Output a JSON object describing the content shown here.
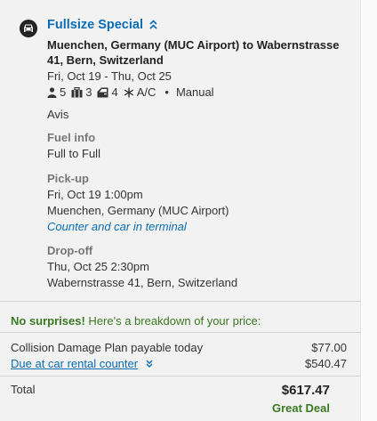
{
  "car": {
    "title": "Fullsize Special",
    "route": "Muenchen, Germany (MUC Airport) to Wabernstrasse 41, Bern, Switzerland",
    "dates": "Fri, Oct 19 - Thu, Oct 25",
    "features": {
      "passengers": "5",
      "bags": "3",
      "doors": "4",
      "ac": "A/C",
      "separator": "•",
      "transmission": "Manual"
    },
    "vendor": "Avis"
  },
  "fuel": {
    "label": "Fuel info",
    "value": "Full to Full"
  },
  "pickup": {
    "label": "Pick-up",
    "datetime": "Fri, Oct 19 1:00pm",
    "location": "Muenchen, Germany (MUC Airport)",
    "note": "Counter and car in terminal"
  },
  "dropoff": {
    "label": "Drop-off",
    "datetime": "Thu, Oct 25 2:30pm",
    "location": "Wabernstrasse 41, Bern, Switzerland"
  },
  "price": {
    "promo_bold": "No surprises!",
    "promo_text": " Here's a breakdown of your price:",
    "lines": [
      {
        "label": "Collision Damage Plan payable today",
        "amount": "$77.00"
      },
      {
        "label": "Due at car rental counter",
        "amount": "$540.47"
      }
    ],
    "total_label": "Total",
    "total_amount": "$617.47",
    "deal_label": "Great Deal"
  },
  "colors": {
    "link": "#0b6db6",
    "green": "#3b7a22"
  },
  "icons": [
    "car-icon",
    "collapse-chevron-icon",
    "passenger-icon",
    "bag-icon",
    "door-icon",
    "snowflake-icon",
    "expand-chevron-icon"
  ]
}
